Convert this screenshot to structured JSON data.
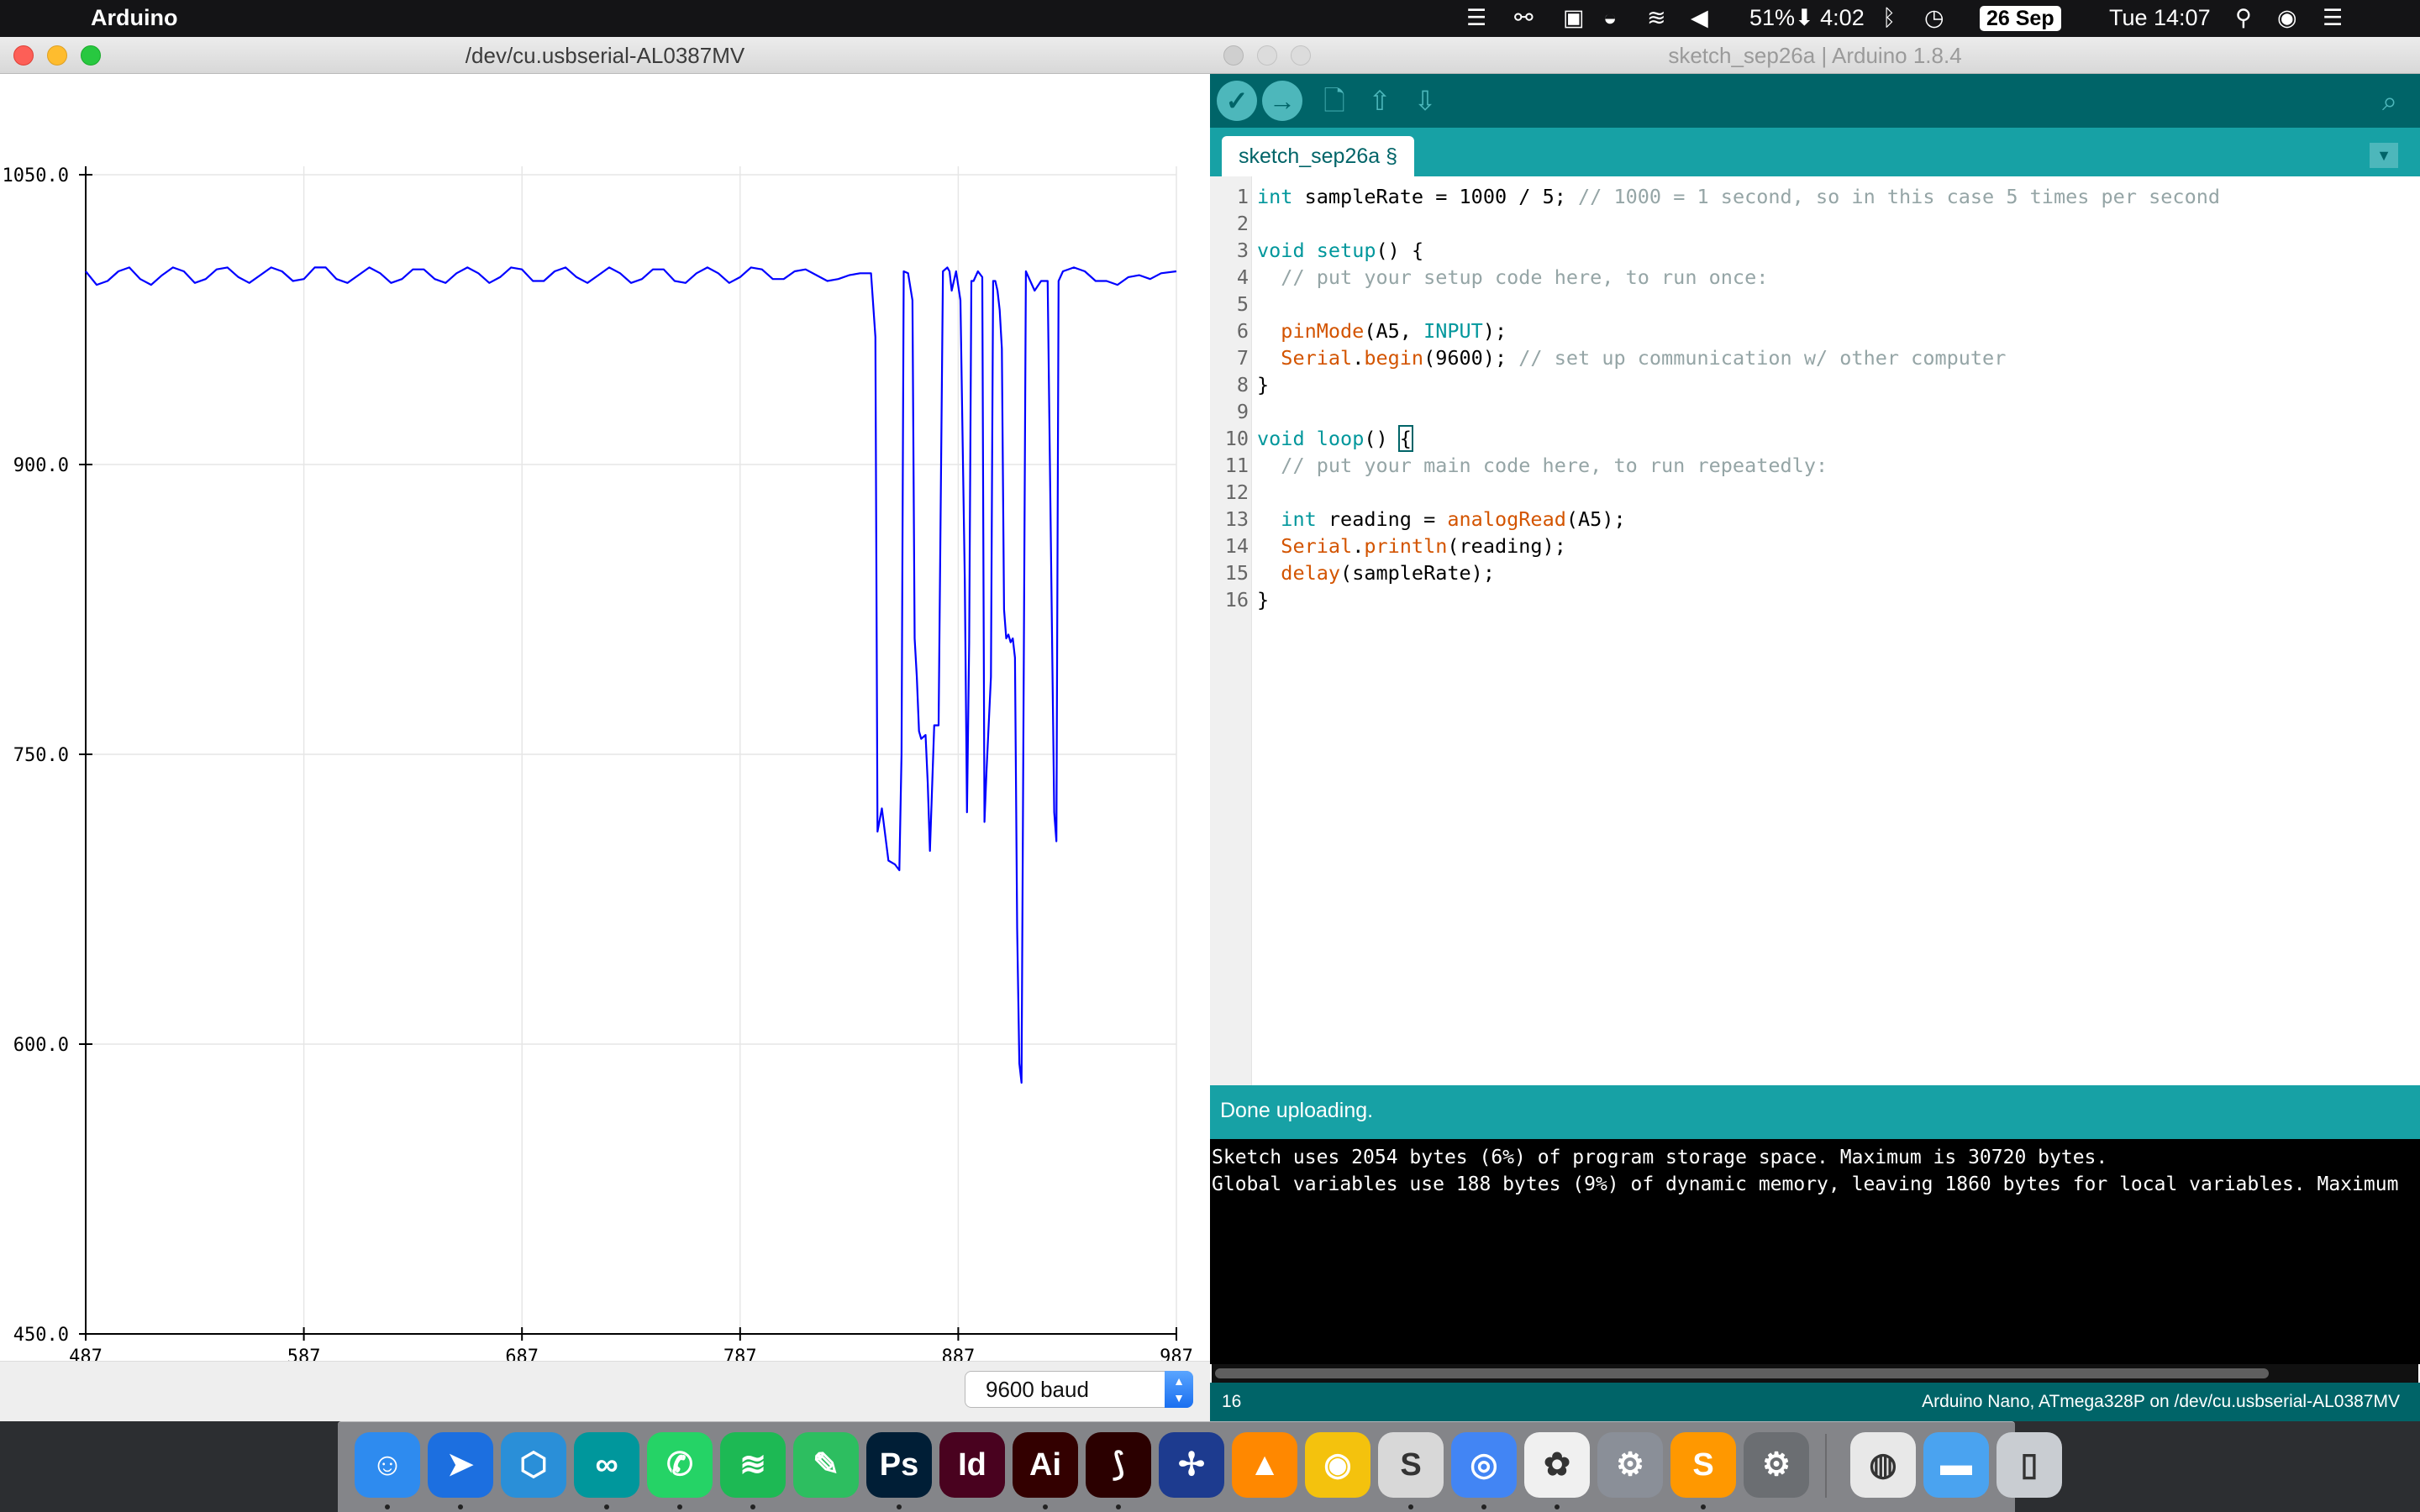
{
  "menubar": {
    "apple_glyph": "",
    "app_name": "Arduino",
    "battery": "51%⬇︎ 4:02",
    "date_badge": "26 Sep",
    "clock": "Tue 14:07"
  },
  "plotter": {
    "title": "/dev/cu.usbserial-AL0387MV",
    "baud": "9600 baud"
  },
  "chart_data": {
    "type": "line",
    "title": "",
    "xlabel": "",
    "ylabel": "",
    "xlim": [
      487,
      987
    ],
    "ylim": [
      450.0,
      1050.0
    ],
    "x_ticks": [
      "487",
      "587",
      "687",
      "787",
      "887",
      "987"
    ],
    "y_ticks": [
      "1050.0",
      "900.0",
      "750.0",
      "600.0",
      "450.0"
    ],
    "grid": true,
    "series": [
      {
        "color": "#0000ff",
        "x": [
          487,
          492,
          497,
          502,
          507,
          512,
          517,
          522,
          527,
          532,
          537,
          542,
          547,
          552,
          557,
          562,
          567,
          572,
          577,
          582,
          587,
          592,
          597,
          602,
          607,
          612,
          617,
          622,
          627,
          632,
          637,
          642,
          647,
          652,
          657,
          662,
          667,
          672,
          677,
          682,
          687,
          692,
          697,
          702,
          707,
          712,
          717,
          722,
          727,
          732,
          737,
          742,
          747,
          752,
          757,
          762,
          767,
          772,
          777,
          782,
          787,
          792,
          797,
          802,
          807,
          812,
          817,
          822,
          827,
          832,
          837,
          842,
          847,
          849,
          850,
          852,
          855,
          858,
          860,
          861,
          862,
          864,
          866,
          867,
          868,
          869,
          870,
          872,
          873,
          874,
          876,
          878,
          880,
          882,
          883,
          884,
          886,
          888,
          890,
          891,
          892,
          893,
          894,
          896,
          898,
          899,
          900,
          902,
          903,
          904,
          905,
          906,
          907,
          908,
          909,
          910,
          911,
          912,
          913,
          914,
          915,
          916,
          918,
          920,
          922,
          925,
          928,
          931,
          932,
          933,
          935,
          940,
          945,
          950,
          955,
          960,
          965,
          970,
          975,
          980,
          987
        ],
        "y": [
          1000,
          993,
          995,
          1000,
          1002,
          996,
          993,
          998,
          1002,
          1000,
          994,
          996,
          1001,
          1002,
          997,
          994,
          998,
          1002,
          1000,
          995,
          996,
          1002,
          1002,
          996,
          994,
          998,
          1002,
          999,
          994,
          996,
          1001,
          1001,
          996,
          994,
          999,
          1002,
          999,
          994,
          997,
          1002,
          1001,
          995,
          995,
          1000,
          1002,
          997,
          994,
          998,
          1002,
          999,
          994,
          996,
          1001,
          1001,
          995,
          994,
          999,
          1002,
          999,
          994,
          997,
          1002,
          1001,
          996,
          996,
          1000,
          1001,
          998,
          995,
          996,
          998,
          999,
          999,
          966,
          710,
          722,
          695,
          693,
          690,
          750,
          1000,
          999,
          985,
          810,
          790,
          762,
          758,
          760,
          735,
          700,
          765,
          765,
          1000,
          1002,
          1000,
          990,
          1000,
          985,
          840,
          720,
          808,
          995,
          995,
          1000,
          997,
          715,
          742,
          790,
          995,
          995,
          990,
          980,
          960,
          825,
          810,
          812,
          808,
          810,
          800,
          660,
          590,
          580,
          1000,
          995,
          990,
          995,
          995,
          720,
          705,
          995,
          1000,
          1002,
          1000,
          995,
          995,
          993,
          997,
          998,
          996,
          999,
          1000
        ]
      }
    ]
  },
  "ide": {
    "title": "sketch_sep26a | Arduino 1.8.4",
    "toolbar": {
      "verify_icon": "✓",
      "upload_icon": "→",
      "new_icon": "new-file-icon",
      "open_icon": "open-icon",
      "save_icon": "save-icon",
      "serial_monitor_icon": "serial-monitor-icon"
    },
    "tab_label": "sketch_sep26a §",
    "tab_menu_icon": "▼",
    "code": [
      {
        "n": "1",
        "parts": [
          {
            "t": "int",
            "c": "kw"
          },
          {
            "t": " sampleRate = 1000 / 5; "
          },
          {
            "t": "// 1000 = 1 second, so in this case 5 times per second",
            "c": "cm"
          }
        ]
      },
      {
        "n": "2",
        "parts": []
      },
      {
        "n": "3",
        "parts": [
          {
            "t": "void",
            "c": "kw"
          },
          {
            "t": " "
          },
          {
            "t": "setup",
            "c": "kw"
          },
          {
            "t": "() {"
          }
        ]
      },
      {
        "n": "4",
        "parts": [
          {
            "t": "  "
          },
          {
            "t": "// put your setup code here, to run once:",
            "c": "cm"
          }
        ]
      },
      {
        "n": "5",
        "parts": []
      },
      {
        "n": "6",
        "parts": [
          {
            "t": "  "
          },
          {
            "t": "pinMode",
            "c": "fn"
          },
          {
            "t": "(A5, "
          },
          {
            "t": "INPUT",
            "c": "kw"
          },
          {
            "t": ");"
          }
        ]
      },
      {
        "n": "7",
        "parts": [
          {
            "t": "  "
          },
          {
            "t": "Serial",
            "c": "fn"
          },
          {
            "t": "."
          },
          {
            "t": "begin",
            "c": "fn"
          },
          {
            "t": "(9600); "
          },
          {
            "t": "// set up communication w/ other computer",
            "c": "cm"
          }
        ]
      },
      {
        "n": "8",
        "parts": [
          {
            "t": "}"
          }
        ]
      },
      {
        "n": "9",
        "parts": []
      },
      {
        "n": "10",
        "parts": [
          {
            "t": "void",
            "c": "kw"
          },
          {
            "t": " "
          },
          {
            "t": "loop",
            "c": "kw"
          },
          {
            "t": "() "
          },
          {
            "t": "{",
            "c": "cursor-brace"
          }
        ]
      },
      {
        "n": "11",
        "parts": [
          {
            "t": "  "
          },
          {
            "t": "// put your main code here, to run repeatedly:",
            "c": "cm"
          }
        ]
      },
      {
        "n": "12",
        "parts": []
      },
      {
        "n": "13",
        "parts": [
          {
            "t": "  "
          },
          {
            "t": "int",
            "c": "kw"
          },
          {
            "t": " reading = "
          },
          {
            "t": "analogRead",
            "c": "fn"
          },
          {
            "t": "(A5);"
          }
        ]
      },
      {
        "n": "14",
        "parts": [
          {
            "t": "  "
          },
          {
            "t": "Serial",
            "c": "fn"
          },
          {
            "t": "."
          },
          {
            "t": "println",
            "c": "fn"
          },
          {
            "t": "(reading);"
          }
        ]
      },
      {
        "n": "15",
        "parts": [
          {
            "t": "  "
          },
          {
            "t": "delay",
            "c": "fn"
          },
          {
            "t": "(sampleRate);"
          }
        ]
      },
      {
        "n": "16",
        "parts": [
          {
            "t": "}"
          }
        ]
      }
    ],
    "status": "Done uploading.",
    "console_lines": [
      "Sketch uses 2054 bytes (6%) of program storage space. Maximum is 30720 bytes.",
      "Global variables use 188 bytes (9%) of dynamic memory, leaving 1860 bytes for local variables. Maximum"
    ],
    "line_number": "16",
    "board": "Arduino Nano, ATmega328P on /dev/cu.usbserial-AL0387MV"
  },
  "dock": {
    "apps": [
      {
        "id": "finder",
        "glyph": "☺",
        "color": "#2e8bef",
        "running": true
      },
      {
        "id": "navigation",
        "glyph": "➤",
        "color": "#1c6fe0",
        "running": true
      },
      {
        "id": "app-store-like",
        "glyph": "⬡",
        "color": "#2a8fd8",
        "running": false
      },
      {
        "id": "arduino",
        "glyph": "∞",
        "color": "#00979c",
        "running": true
      },
      {
        "id": "whatsapp",
        "glyph": "✆",
        "color": "#25d366",
        "running": true
      },
      {
        "id": "spotify",
        "glyph": "≋",
        "color": "#1db954",
        "running": true
      },
      {
        "id": "evernote",
        "glyph": "✎",
        "color": "#2dbe60",
        "running": false
      },
      {
        "id": "photoshop",
        "glyph": "Ps",
        "color": "#001e36",
        "running": true
      },
      {
        "id": "indesign",
        "glyph": "Id",
        "color": "#49021f",
        "running": false
      },
      {
        "id": "illustrator",
        "glyph": "Ai",
        "color": "#330000",
        "running": true
      },
      {
        "id": "acrobat",
        "glyph": "⟆",
        "color": "#2b0000",
        "running": true
      },
      {
        "id": "joystick",
        "glyph": "✢",
        "color": "#1d3b8f",
        "running": false
      },
      {
        "id": "vlc",
        "glyph": "▲",
        "color": "#ff8800",
        "running": false
      },
      {
        "id": "cyberduck",
        "glyph": "◉",
        "color": "#f4c20d",
        "running": false
      },
      {
        "id": "scrivener",
        "glyph": "S",
        "color": "#d8d8d8",
        "running": true
      },
      {
        "id": "chrome",
        "glyph": "◎",
        "color": "#4285f4",
        "running": true
      },
      {
        "id": "photos",
        "glyph": "✿",
        "color": "#f0f0f0",
        "running": true
      },
      {
        "id": "transmission",
        "glyph": "⚙",
        "color": "#8a8f98",
        "running": false
      },
      {
        "id": "sublime",
        "glyph": "S",
        "color": "#ff9800",
        "running": true
      },
      {
        "id": "system-preferences",
        "glyph": "⚙",
        "color": "#6b6e72",
        "running": false
      },
      {
        "id": "preview-doc",
        "glyph": "◍",
        "color": "#e8e8e8",
        "running": false
      },
      {
        "id": "folder",
        "glyph": "▬",
        "color": "#4aa3f0",
        "running": false
      },
      {
        "id": "trash",
        "glyph": "▯",
        "color": "#c9cdd2",
        "running": false
      }
    ]
  }
}
